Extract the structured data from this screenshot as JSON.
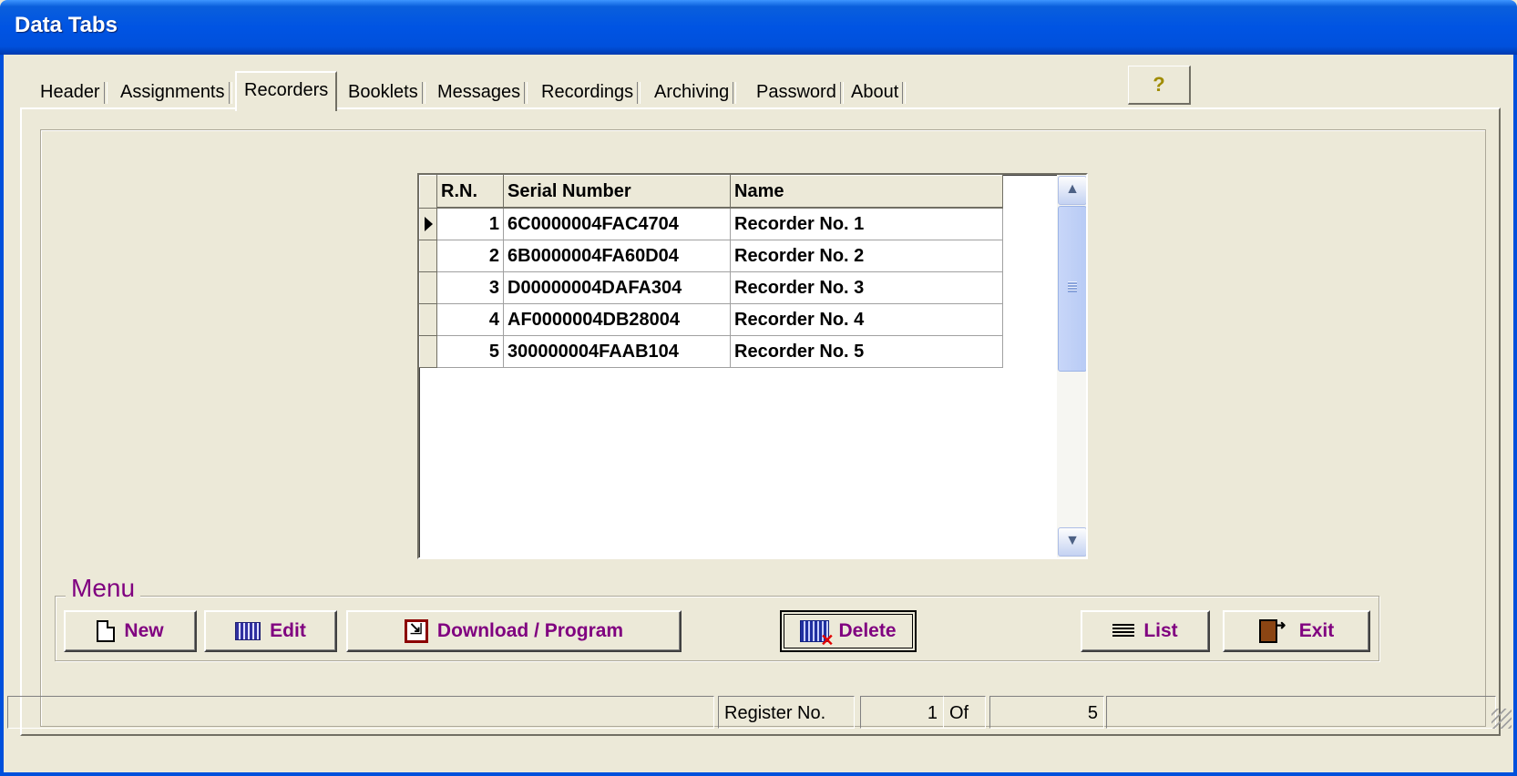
{
  "window": {
    "title": "Data Tabs"
  },
  "tabs": [
    {
      "label": "Header"
    },
    {
      "label": "Assignments"
    },
    {
      "label": "Recorders",
      "active": true
    },
    {
      "label": "Booklets"
    },
    {
      "label": "Messages"
    },
    {
      "label": "Recordings"
    },
    {
      "label": "Archiving"
    },
    {
      "label": "Password"
    },
    {
      "label": "About"
    }
  ],
  "help_button": {
    "icon": "question-mark-icon",
    "label": "?"
  },
  "grid": {
    "columns": [
      "R.N.",
      "Serial Number",
      "Name"
    ],
    "rows": [
      {
        "rn": "1",
        "serial": "6C0000004FAC4704",
        "name": "Recorder No. 1",
        "current": true
      },
      {
        "rn": "2",
        "serial": "6B0000004FA60D04",
        "name": "Recorder No. 2"
      },
      {
        "rn": "3",
        "serial": "D00000004DAFA304",
        "name": "Recorder No. 3"
      },
      {
        "rn": "4",
        "serial": "AF0000004DB28004",
        "name": "Recorder No. 4"
      },
      {
        "rn": "5",
        "serial": "300000004FAAB104",
        "name": "Recorder No. 5"
      }
    ]
  },
  "menu": {
    "legend": "Menu",
    "buttons": {
      "new": "New",
      "edit": "Edit",
      "download": "Download / Program",
      "delete": "Delete",
      "list": "List",
      "exit": "Exit"
    }
  },
  "status": {
    "register_label": "Register No.",
    "current": "1",
    "of_label": "Of",
    "total": "5"
  },
  "colors": {
    "accent": "#800080",
    "titlebar": "#0054E3",
    "face": "#ECE9D8"
  }
}
